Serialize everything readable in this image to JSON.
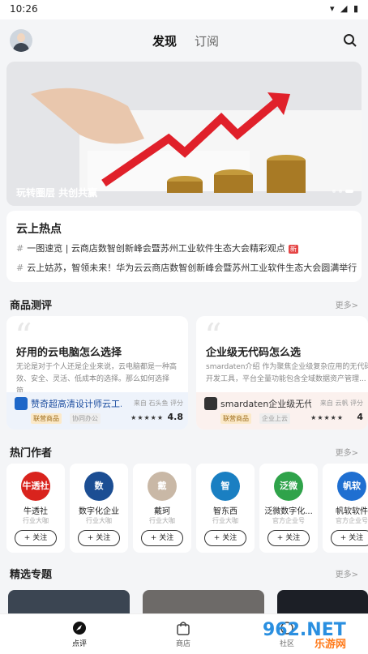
{
  "status": {
    "time": "10:26",
    "icons": "▾ ◢ ▮"
  },
  "header": {
    "tabs": [
      "发现",
      "订阅"
    ]
  },
  "banner": {
    "caption": "玩转圈层 共创共赢",
    "slides": 3,
    "active": 2
  },
  "hot": {
    "title": "云上热点",
    "items": [
      "一图速览 | 云商店数智创新峰会暨苏州工业软件生态大会精彩观点",
      "云上姑苏，智领未来！华为云云商店数智创新峰会暨苏州工业软件生态大会圆满举行"
    ],
    "new_badge": "新"
  },
  "review": {
    "title": "商品测评",
    "more": "更多>",
    "cards": [
      {
        "title": "好用的云电脑怎么选择",
        "desc": "无论是对于个人还是企业来说，云电脑都是一种高效、安全、灵活、低成本的选择。那么如何选择简...",
        "product": "赞奇超高清设计师云工...",
        "source": "来自 石头鱼 评分",
        "tag": "联营商品",
        "tag2": "协同办公",
        "stars": "★★★★★",
        "score": "4.8"
      },
      {
        "title": "企业级无代码怎么选",
        "desc": "smardaten介绍 作为聚焦企业级复杂应用的无代码开发工具，平台全量功能包含全域数据资产管理...",
        "product": "smardaten企业级无代码...",
        "source": "来自 云帆 评分",
        "tag": "联营商品",
        "tag2": "企业上云",
        "stars": "★★★★★",
        "score": "4"
      }
    ]
  },
  "authors": {
    "title": "热门作者",
    "more": "更多>",
    "follow": "+ 关注",
    "list": [
      {
        "name": "牛透社",
        "role": "行业大咖",
        "logo": "牛透社",
        "color": "#d9231d"
      },
      {
        "name": "数字化企业",
        "role": "行业大咖",
        "logo": "数",
        "color": "#1c4e93"
      },
      {
        "name": "戴珂",
        "role": "行业大咖",
        "logo": "戴",
        "color": "#c9b8a6"
      },
      {
        "name": "智东西",
        "role": "行业大咖",
        "logo": "智",
        "color": "#1a7fc2"
      },
      {
        "name": "泛微数字化...",
        "role": "官方企业号",
        "logo": "泛微",
        "color": "#2fa34a"
      },
      {
        "name": "帆软软件",
        "role": "官方企业号",
        "logo": "帆软",
        "color": "#1f6fd1"
      }
    ]
  },
  "topics": {
    "title": "精选专题",
    "more": "更多>"
  },
  "nav": {
    "items": [
      "点评",
      "商店",
      "社区"
    ]
  },
  "watermark": {
    "text": "962.NET",
    "sub": "乐游网"
  },
  "colors": {
    "accent": "#e54545",
    "brand": "#1e67c8"
  }
}
